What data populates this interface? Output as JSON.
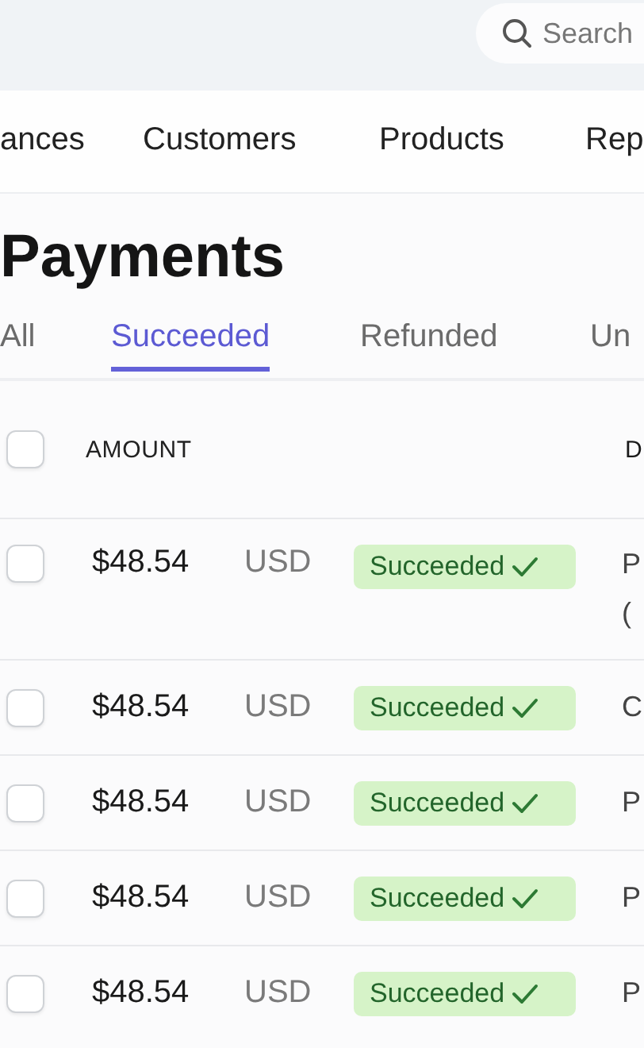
{
  "search": {
    "placeholder": "Search"
  },
  "nav": [
    {
      "label": "ances"
    },
    {
      "label": "Customers"
    },
    {
      "label": "Products"
    },
    {
      "label": "Rep"
    }
  ],
  "title": "Payments",
  "tabs": [
    {
      "label": "All",
      "selected": false
    },
    {
      "label": "Succeeded",
      "selected": true
    },
    {
      "label": "Refunded",
      "selected": false
    },
    {
      "label": "Un",
      "selected": false
    }
  ],
  "table": {
    "select_all": {
      "checked": false
    },
    "columns": [
      "AMOUNT",
      "D"
    ],
    "rows": [
      {
        "checked": false,
        "amount": "$48.54",
        "currency": "USD",
        "status": "Succeeded",
        "description": [
          "P",
          "("
        ]
      },
      {
        "checked": false,
        "amount": "$48.54",
        "currency": "USD",
        "status": "Succeeded",
        "description": [
          "C"
        ]
      },
      {
        "checked": false,
        "amount": "$48.54",
        "currency": "USD",
        "status": "Succeeded",
        "description": [
          "P"
        ]
      },
      {
        "checked": false,
        "amount": "$48.54",
        "currency": "USD",
        "status": "Succeeded",
        "description": [
          "P"
        ]
      },
      {
        "checked": false,
        "amount": "$48.54",
        "currency": "USD",
        "status": "Succeeded",
        "description": [
          "P"
        ]
      }
    ]
  }
}
